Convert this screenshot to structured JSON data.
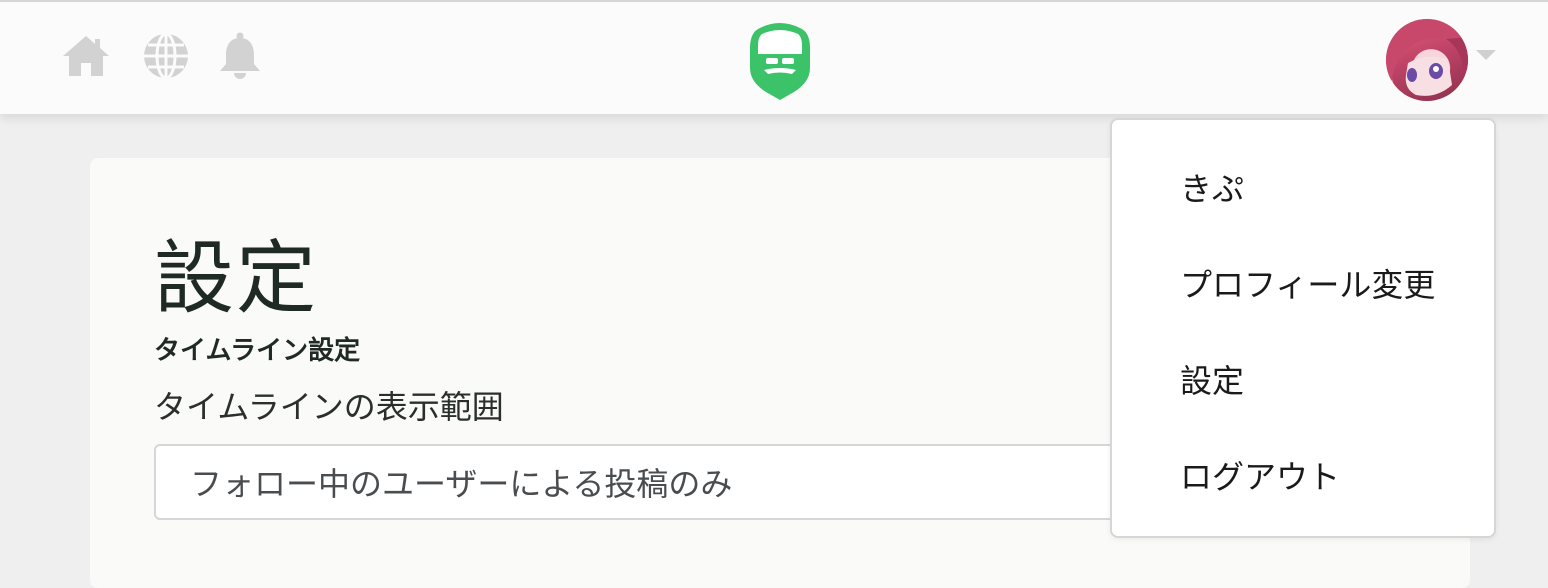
{
  "header": {
    "icons": [
      "home-icon",
      "globe-icon",
      "bell-icon"
    ],
    "logo": "bearded-mask-logo",
    "brand_color": "#3cc36a",
    "icon_color": "#d2d2d2"
  },
  "user_menu": {
    "items": [
      {
        "label": "きぷ"
      },
      {
        "label": "プロフィール変更"
      },
      {
        "label": "設定"
      },
      {
        "label": "ログアウト"
      }
    ]
  },
  "page": {
    "title": "設定",
    "section": "タイムライン設定",
    "field_label": "タイムラインの表示範囲",
    "select_value": "フォロー中のユーザーによる投稿のみ"
  }
}
